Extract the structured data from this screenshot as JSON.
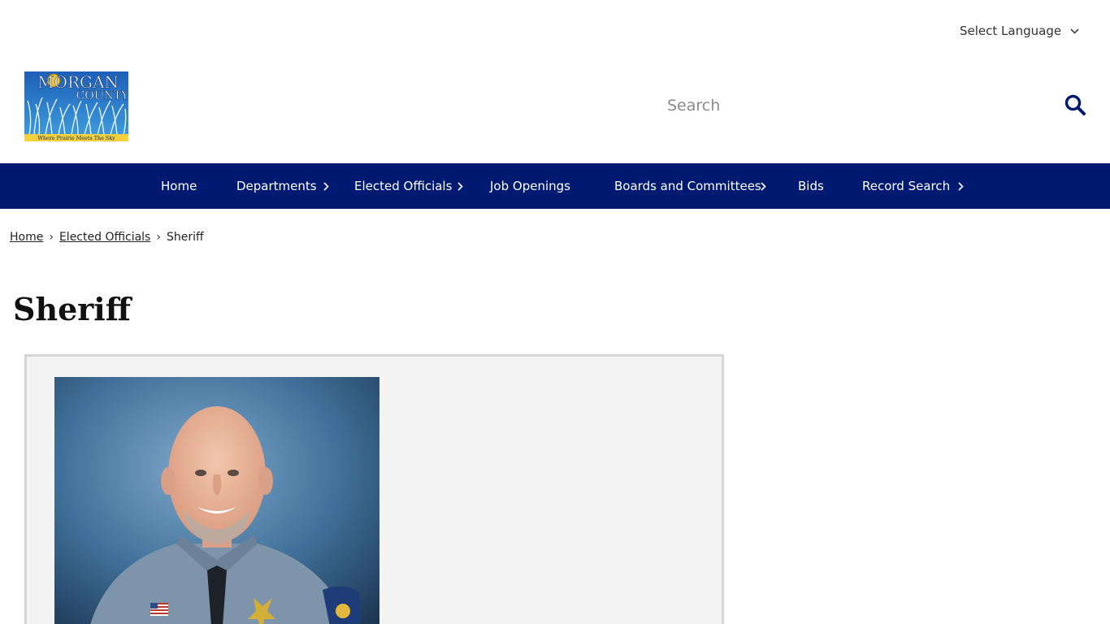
{
  "language": {
    "label": "Select Language",
    "icon": "chevron-down-icon"
  },
  "logo": {
    "title_top": "MORGAN",
    "title_bottom": "COUNTY",
    "tagline": "Where Prairie Meets The Sky"
  },
  "search": {
    "placeholder": "Search",
    "icon": "search-icon"
  },
  "nav": {
    "items": [
      {
        "label": "Home",
        "has_submenu": false
      },
      {
        "label": "Departments",
        "has_submenu": true
      },
      {
        "label": "Elected Officials",
        "has_submenu": true
      },
      {
        "label": "Job Openings",
        "has_submenu": false
      },
      {
        "label": "Boards and Committees",
        "has_submenu": true
      },
      {
        "label": "Bids",
        "has_submenu": false
      },
      {
        "label": "Record Search",
        "has_submenu": true
      }
    ]
  },
  "breadcrumb": {
    "items": [
      "Home",
      "Elected Officials"
    ],
    "current": "Sheriff",
    "separator": "›"
  },
  "page": {
    "title": "Sheriff"
  },
  "colors": {
    "nav_bg": "#001a72",
    "search_icon": "#001a72",
    "card_bg": "#f4f4f4",
    "card_border": "#d6d6d6"
  }
}
